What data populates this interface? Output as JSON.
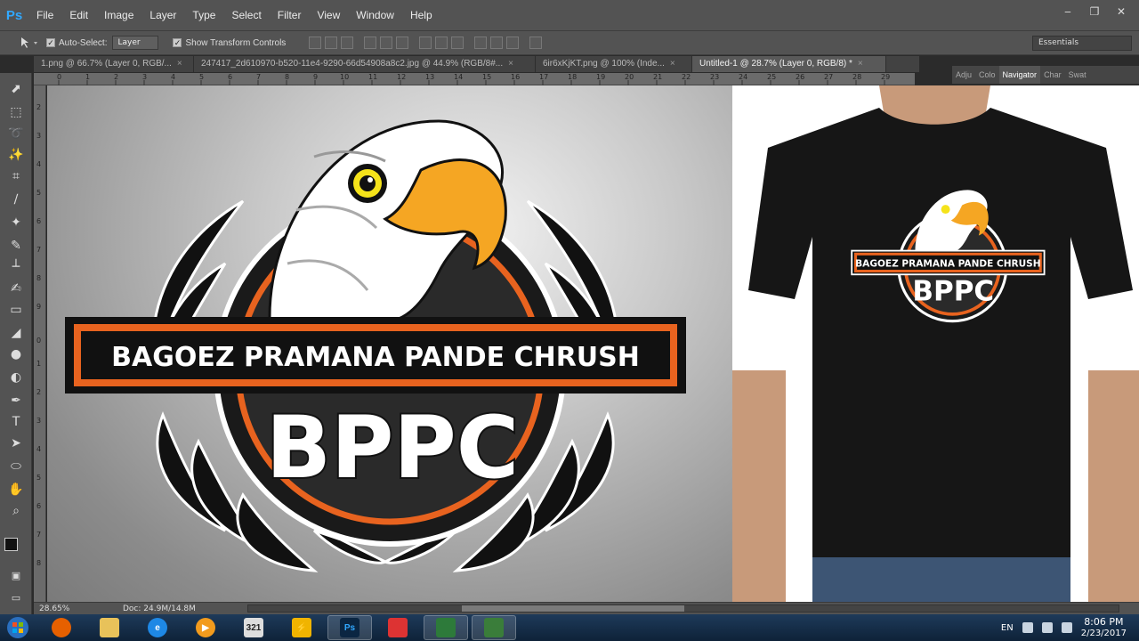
{
  "app": {
    "name": "Ps",
    "menus": [
      "File",
      "Edit",
      "Image",
      "Layer",
      "Type",
      "Select",
      "Filter",
      "View",
      "Window",
      "Help"
    ]
  },
  "options": {
    "auto_select_label": "Auto-Select:",
    "auto_select_value": "Layer",
    "transform_label": "Show Transform Controls",
    "workspace": "Essentials"
  },
  "tabs": [
    {
      "label": "1.png @ 66.7% (Layer 0, RGB/...",
      "active": false
    },
    {
      "label": "247417_2d610970-b520-11e4-9290-66d54908a8c2.jpg @ 44.9% (RGB/8#...",
      "active": false
    },
    {
      "label": "6ir6xKjKT.png @ 100% (Inde...",
      "active": false
    },
    {
      "label": "Untitled-1 @ 28.7% (Layer 0, RGB/8) *",
      "active": true
    }
  ],
  "panels": [
    "Adju",
    "Colo",
    "Navigator",
    "Char",
    "Swat"
  ],
  "ruler_top": [
    "0",
    "1",
    "2",
    "3",
    "4",
    "5",
    "6",
    "7",
    "8",
    "9",
    "10",
    "11",
    "12",
    "13",
    "14",
    "15",
    "16",
    "17",
    "18",
    "19",
    "20",
    "21",
    "22",
    "23",
    "24",
    "25",
    "26",
    "27",
    "28",
    "29"
  ],
  "ruler_left": [
    "2",
    "3",
    "4",
    "5",
    "6",
    "7",
    "8",
    "9",
    "0",
    "1",
    "2",
    "3",
    "4",
    "5",
    "6",
    "7",
    "8"
  ],
  "artwork": {
    "banner_text": "BAGOEZ PRAMANA PANDE CHRUSH",
    "logo_text": "BPPC"
  },
  "status": {
    "zoom": "28.65%",
    "doc": "Doc: 24.9M/14.8M"
  },
  "taskbar": {
    "lang": "EN",
    "time": "8:06 PM",
    "date": "2/23/2017"
  }
}
